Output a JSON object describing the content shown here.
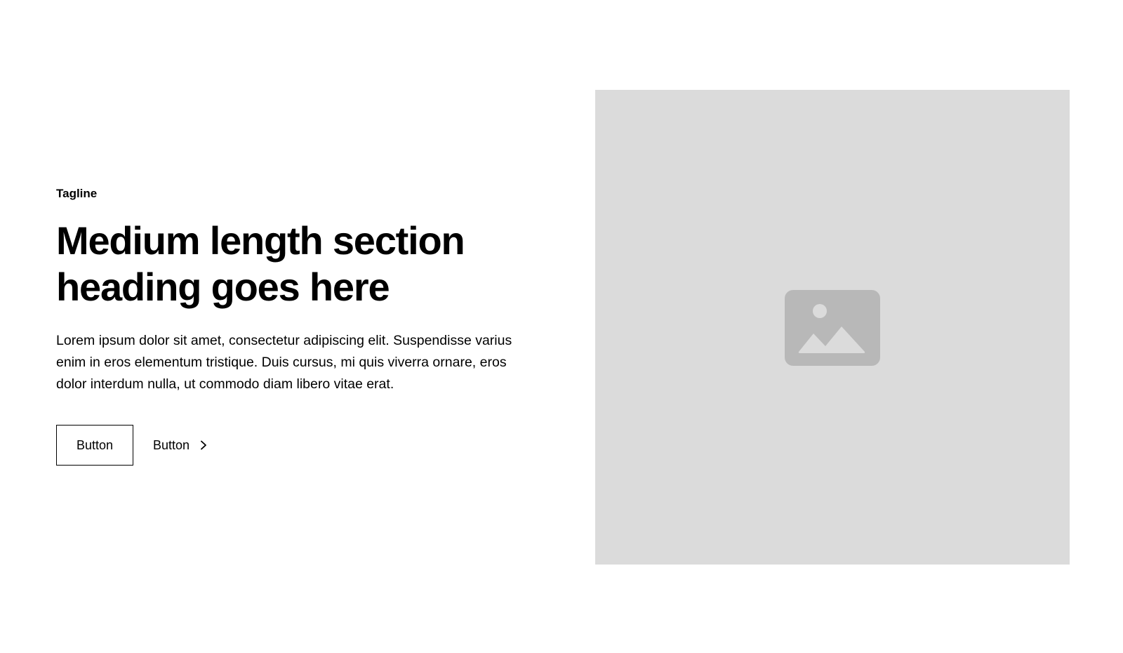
{
  "hero": {
    "tagline": "Tagline",
    "heading": "Medium length section heading goes here",
    "body": "Lorem ipsum dolor sit amet, consectetur adipiscing elit. Suspendisse varius enim in eros elementum tristique. Duis cursus, mi quis viverra ornare, eros dolor interdum nulla, ut commodo diam libero vitae erat.",
    "primary_button_label": "Button",
    "secondary_button_label": "Button",
    "secondary_button_icon": "chevron-right-icon"
  },
  "media": {
    "icon": "image-icon",
    "placeholder_color": "#dbdbdb",
    "icon_color": "#b8b8b8"
  }
}
